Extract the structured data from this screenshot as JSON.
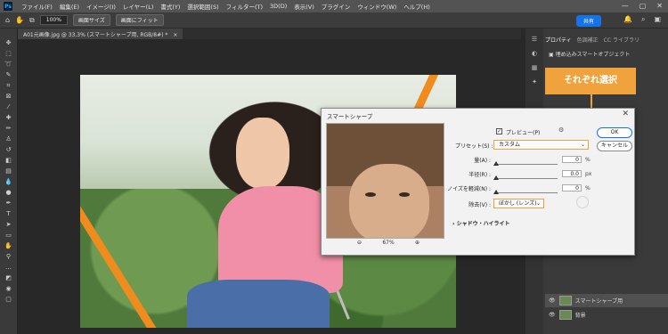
{
  "menubar": {
    "logo": "Ps",
    "items": [
      "ファイル(F)",
      "編集(E)",
      "イメージ(I)",
      "レイヤー(L)",
      "書式(Y)",
      "選択範囲(S)",
      "フィルター(T)",
      "3D(D)",
      "表示(V)",
      "プラグイン",
      "ウィンドウ(W)",
      "ヘルプ(H)"
    ],
    "window_controls": [
      "—",
      "▢",
      "✕"
    ]
  },
  "options_bar": {
    "zoom_value": "100%",
    "fit_screen": "画面サイズ",
    "fill_screen": "画面にフィット",
    "share": "共有"
  },
  "document": {
    "tab_title": "A01元画像.jpg @ 33.3% (スマートシャープ用, RGB/8#) *",
    "tab_close": "×"
  },
  "panels": {
    "tabs": [
      "プロパティ",
      "色調補正",
      "CC ライブラリ"
    ],
    "smart_object_label": "埋め込みスマートオブジェクト",
    "layers": [
      {
        "name": "スマートシャープ用"
      },
      {
        "name": "背景"
      }
    ]
  },
  "callout": {
    "text": "それぞれ選択"
  },
  "dialog": {
    "title": "スマートシャープ",
    "close": "✕",
    "ok": "OK",
    "cancel": "キャンセル",
    "preview_label": "プレビュー(P)",
    "preview_checked": "✓",
    "preset_label": "プリセット(S) :",
    "preset_value": "カスタム",
    "amount_label": "量(A) :",
    "amount_value": "0",
    "amount_unit": "%",
    "radius_label": "半径(R) :",
    "radius_value": "0.0",
    "radius_unit": "px",
    "noise_label": "ノイズを軽減(N) :",
    "noise_value": "0",
    "noise_unit": "%",
    "remove_label": "除去(V) :",
    "remove_value": "ぼかし (レンズ)",
    "shadow_highlight": "シャドウ・ハイライト",
    "zoom_percent": "67%",
    "zoom_out": "⊖",
    "zoom_in": "⊕",
    "gear": "⚙"
  },
  "colors": {
    "accent": "#f0a23c",
    "share_blue": "#1473e6"
  }
}
